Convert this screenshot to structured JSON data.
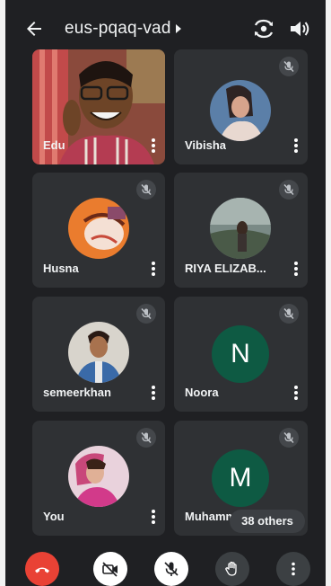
{
  "meeting": {
    "code": "eus-pqaq-vad"
  },
  "participants": [
    {
      "name": "Edu",
      "type": "video"
    },
    {
      "name": "Vibisha",
      "type": "photo",
      "muted": true
    },
    {
      "name": "Husna",
      "type": "photo",
      "muted": true
    },
    {
      "name": "RIYA ELIZAB...",
      "type": "photo",
      "muted": true
    },
    {
      "name": "semeerkhan",
      "type": "photo",
      "muted": true
    },
    {
      "name": "Noora",
      "type": "letter",
      "initial": "N",
      "muted": true
    },
    {
      "name": "You",
      "type": "photo",
      "muted": true
    },
    {
      "name": "Muhamm",
      "type": "letter",
      "initial": "M",
      "muted": true
    }
  ],
  "others_label": "38 others",
  "colors": {
    "background": "#1f2023",
    "tile": "#2f3134",
    "end_call": "#e94235",
    "avatar_green": "#0e5a43"
  },
  "icons": {
    "back": "arrow-left-icon",
    "meeting_info": "caret-right-icon",
    "flip_camera": "flip-camera-icon",
    "audio_output": "speaker-icon",
    "muted": "mic-off-icon",
    "more": "more-vert-icon",
    "end_call": "call-end-icon",
    "camera": "videocam-off-icon",
    "mic": "mic-off-icon",
    "raise_hand": "hand-icon",
    "more_options": "more-vert-icon"
  }
}
